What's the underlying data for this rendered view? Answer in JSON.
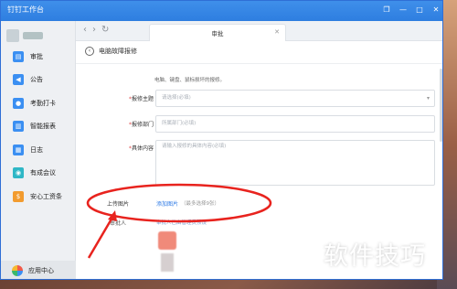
{
  "window": {
    "title": "钉钉工作台"
  },
  "sidebar": {
    "items": [
      {
        "label": "审批",
        "icon": "approval-icon",
        "color": "#3b8ff2"
      },
      {
        "label": "公告",
        "icon": "megaphone-icon",
        "color": "#3b8ff2"
      },
      {
        "label": "考勤打卡",
        "icon": "location-pin-icon",
        "color": "#3b8ff2"
      },
      {
        "label": "智能报表",
        "icon": "chart-icon",
        "color": "#3b8ff2"
      },
      {
        "label": "日志",
        "icon": "log-icon",
        "color": "#3b8ff2"
      },
      {
        "label": "有成会议",
        "icon": "meeting-icon",
        "color": "#2fb7c6"
      },
      {
        "label": "安心工资条",
        "icon": "payslip-icon",
        "color": "#f29b2f"
      }
    ],
    "app_center": "应用中心"
  },
  "tabbar": {
    "active_tab": "审批"
  },
  "form": {
    "title": "电脑故障报修",
    "description": "电脑、键盘、鼠标损坏的报修。",
    "fields": [
      {
        "label": "报修主题",
        "required": true,
        "placeholder": "请选择(必填)"
      },
      {
        "label": "报修部门",
        "required": true,
        "placeholder": "所属部门(必填)"
      },
      {
        "label": "具体内容",
        "required": true,
        "placeholder": "请输入报修的具体内容(必填)"
      }
    ],
    "upload": {
      "label": "上传图片",
      "link": "添加图片",
      "note": "（最多选择9张）"
    },
    "approver": {
      "label": "审批人",
      "hint": "审批人已由管理员预设"
    }
  },
  "watermark": "软件技巧",
  "colors": {
    "titlebar": "#2e7ee0",
    "link": "#2f7be6",
    "annotation": "#e8231e",
    "required": "#e04b4b"
  }
}
